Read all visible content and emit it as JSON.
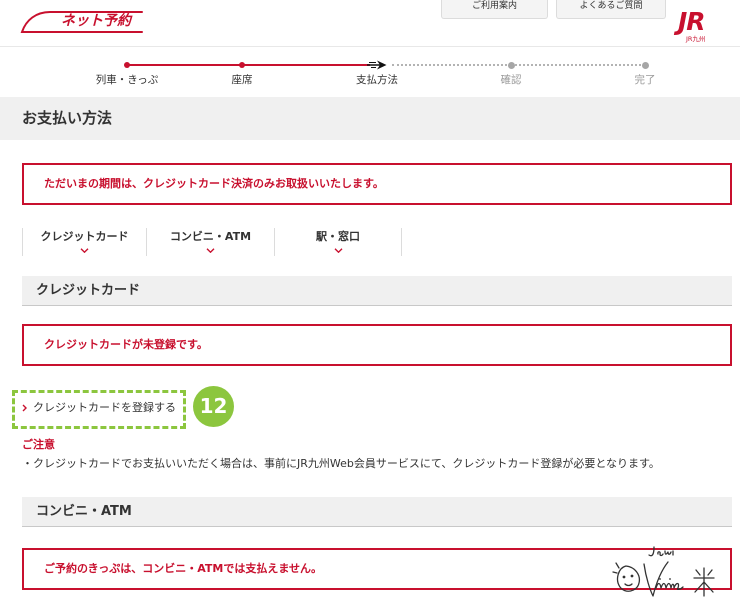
{
  "header": {
    "logo_text": "ネット予約",
    "nav": [
      {
        "label": "ご利用案内"
      },
      {
        "label": "よくあるご質問"
      }
    ],
    "brand_mark": "JR",
    "brand_sub": "JR九州"
  },
  "progress": {
    "current_step": 3,
    "steps": [
      {
        "label": "列車・きっぷ"
      },
      {
        "label": "座席"
      },
      {
        "label": "支払方法"
      },
      {
        "label": "確認"
      },
      {
        "label": "完了"
      }
    ]
  },
  "page_title": "お支払い方法",
  "notice": "ただいまの期間は、クレジットカード決済のみお取扱いいたします。",
  "payment_tabs": [
    {
      "label": "クレジットカード"
    },
    {
      "label": "コンビニ・ATM"
    },
    {
      "label": "駅・窓口"
    }
  ],
  "credit_card": {
    "heading": "クレジットカード",
    "status": "クレジットカードが未登録です。",
    "register_link": "クレジットカードを登録する",
    "caution_title": "ご注意",
    "caution_text": "・クレジットカードでお支払いいただく場合は、事前にJR九州Web会員サービスにて、クレジットカード登録が必要となります。"
  },
  "convenience": {
    "heading": "コンビニ・ATM",
    "status": "ご予約のきっぷは、コンビニ・ATMでは支払えません。"
  },
  "annotation": {
    "step_number": "12"
  },
  "icons": {
    "logo": "shinkansen-logo-icon",
    "step_marker": "arrow-right-icon",
    "tab_marker": "chevron-down-icon",
    "link_marker": "chevron-right-icon",
    "watermark": "handwritten-signature-icon"
  },
  "colors": {
    "accent": "#c8102e",
    "annotation": "#8cc63e",
    "panel": "#f0f0f0",
    "text": "#333333",
    "muted": "#999999",
    "divider": "#dddddd"
  }
}
